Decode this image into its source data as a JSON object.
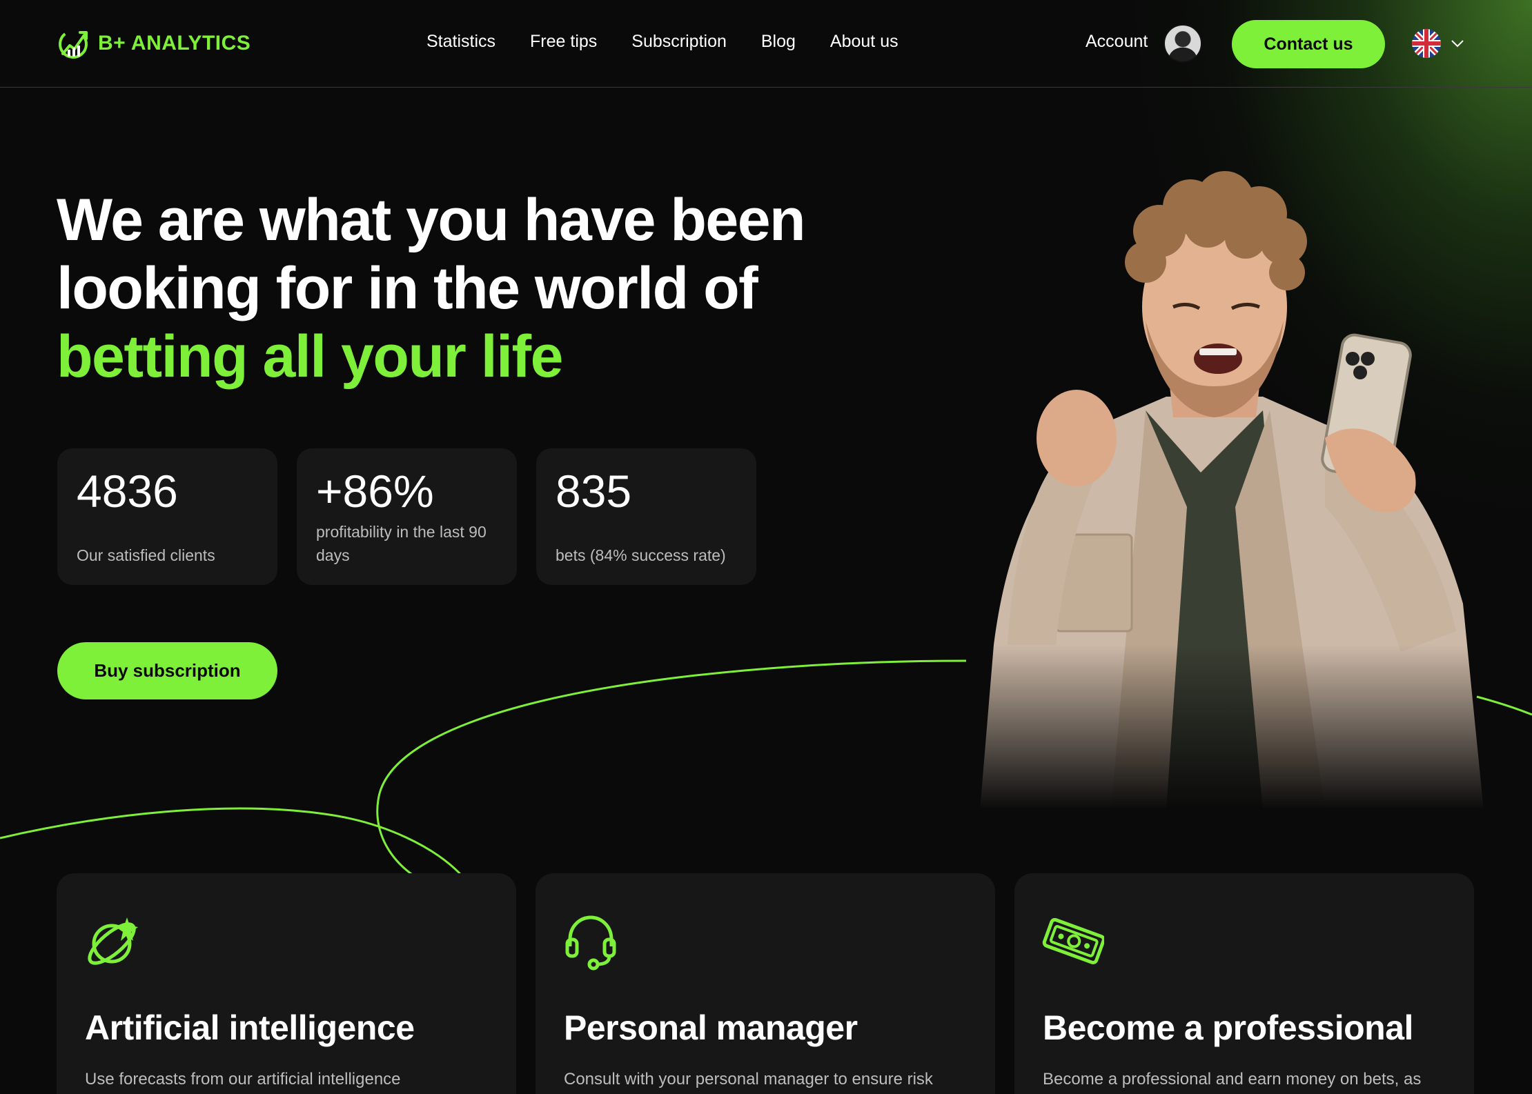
{
  "brand": {
    "name": "B+ ANALYTICS",
    "accent": "#7ef03a",
    "background": "#0a0a0a",
    "card_bg": "#171717"
  },
  "nav": {
    "items": [
      {
        "label": "Statistics"
      },
      {
        "label": "Free tips"
      },
      {
        "label": "Subscription"
      },
      {
        "label": "Blog"
      },
      {
        "label": "About us"
      }
    ],
    "account_label": "Account",
    "contact_label": "Contact us",
    "language": "uk-flag-icon"
  },
  "hero": {
    "title_line1": "We are what you have been",
    "title_line2": "looking for in the world of",
    "title_highlight": "betting all your life",
    "stats": [
      {
        "value": "4836",
        "label": "Our satisfied clients"
      },
      {
        "value": "+86%",
        "label": "profitability in the last 90 days"
      },
      {
        "value": "835",
        "label": "bets (84% success rate)"
      }
    ],
    "cta_label": "Buy subscription"
  },
  "features": [
    {
      "icon": "ai-orbit-icon",
      "title": "Artificial intelligence",
      "desc": "Use forecasts from our artificial intelligence"
    },
    {
      "icon": "headset-icon",
      "title": "Personal manager",
      "desc": "Consult with your personal manager to ensure risk"
    },
    {
      "icon": "money-bill-icon",
      "title": "Become a professional",
      "desc": "Become a professional and earn money on bets, as"
    }
  ]
}
